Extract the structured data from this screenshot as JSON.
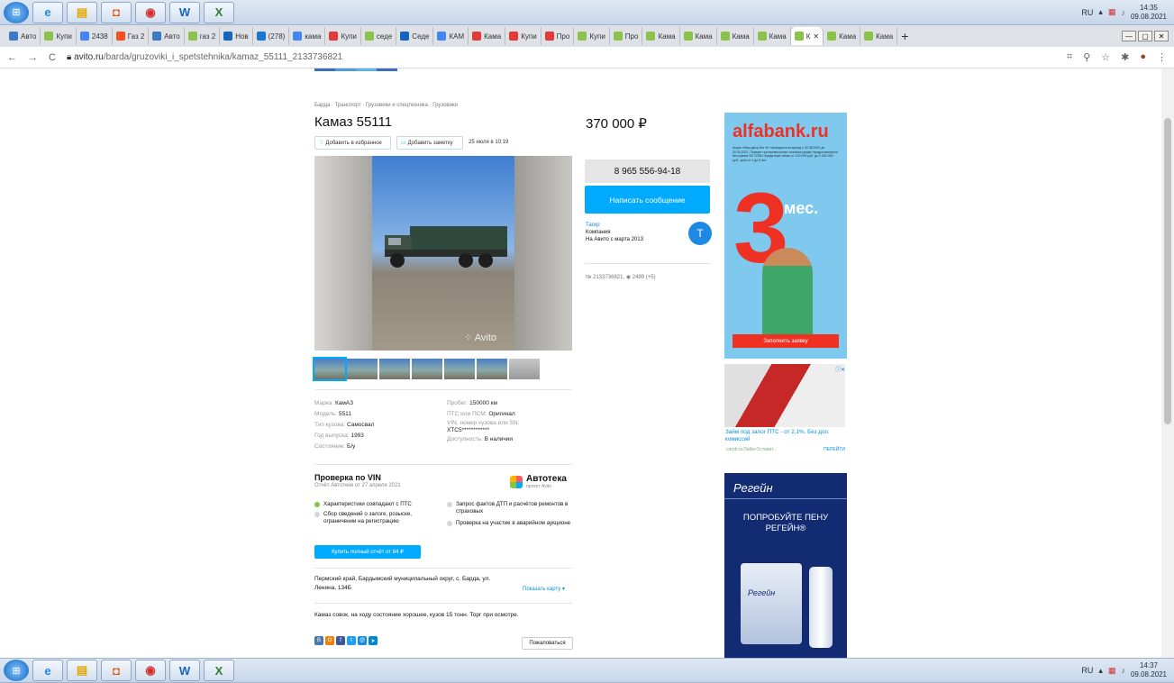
{
  "taskbar": {
    "lang": "RU",
    "time_top": "14:35",
    "date_top": "09.08.2021",
    "time_bottom": "14:37",
    "date_bottom": "09.08.2021"
  },
  "tabs": [
    {
      "label": "Авто",
      "color": "#3c7ac6"
    },
    {
      "label": "Купи",
      "color": "#8bc34a"
    },
    {
      "label": "2438",
      "color": "#4285f4"
    },
    {
      "label": "Газ 2",
      "color": "#f4511e"
    },
    {
      "label": "Авто",
      "color": "#3c7ac6"
    },
    {
      "label": "газ 2",
      "color": "#8bc34a"
    },
    {
      "label": "Нов",
      "color": "#1565c0"
    },
    {
      "label": "(278)",
      "color": "#1976d2"
    },
    {
      "label": "кама",
      "color": "#4285f4"
    },
    {
      "label": "Купи",
      "color": "#e53935"
    },
    {
      "label": "седе",
      "color": "#8bc34a"
    },
    {
      "label": "Седе",
      "color": "#1565c0"
    },
    {
      "label": "КАМ",
      "color": "#4285f4"
    },
    {
      "label": "Кама",
      "color": "#e53935"
    },
    {
      "label": "Купи",
      "color": "#e53935"
    },
    {
      "label": "Про",
      "color": "#e53935"
    },
    {
      "label": "Купи",
      "color": "#8bc34a"
    },
    {
      "label": "Про",
      "color": "#8bc34a"
    },
    {
      "label": "Кама",
      "color": "#8bc34a"
    },
    {
      "label": "Кама",
      "color": "#8bc34a"
    },
    {
      "label": "Кама",
      "color": "#8bc34a"
    },
    {
      "label": "Кама",
      "color": "#8bc34a"
    },
    {
      "label": "К",
      "color": "#8bc34a",
      "active": true
    },
    {
      "label": "Кама",
      "color": "#8bc34a"
    },
    {
      "label": "Кама",
      "color": "#8bc34a"
    }
  ],
  "address": {
    "host": "avito.ru",
    "path": "/barda/gruzoviki_i_spetstehnika/kamaz_55111_2133736821"
  },
  "listing": {
    "breadcrumb": "Барда · Транспорт · Грузовики и спецтехника · Грузовики",
    "title": "Камаз 55111",
    "price": "370 000 ₽",
    "fav_label": "Добавить в избранное",
    "note_label": "Добавить заметку",
    "date": "25 июля в 10:19",
    "watermark": "Avito",
    "props_left": [
      {
        "k": "Марка: ",
        "v": "КамАЗ"
      },
      {
        "k": "Модель: ",
        "v": "5511"
      },
      {
        "k": "Тип кузова: ",
        "v": "Самосвал"
      },
      {
        "k": "Год выпуска: ",
        "v": "1993"
      },
      {
        "k": "Состояние: ",
        "v": "Б/у"
      }
    ],
    "props_right": [
      {
        "k": "Пробег: ",
        "v": "150000 км"
      },
      {
        "k": "ПТС или ПСМ: ",
        "v": "Оригинал"
      },
      {
        "k": "VIN, номер кузова или SN:",
        "v": "XTC5************"
      },
      {
        "k": "Доступность: ",
        "v": "В наличии"
      }
    ],
    "vin": {
      "title": "Проверка по VIN",
      "subtitle": "Отчёт Автотеки от 27 апреля 2021",
      "brand": "Автотека",
      "brand_sub": "проект Avito",
      "checks_left": [
        "Характеристики совпадают с ПТС",
        "Сбор сведений о залоге, розыске, ограничении на регистрацию"
      ],
      "checks_right": [
        "Запрос фактов ДТП и расчётов ремонтов в страховых",
        "Проверка на участие в аварийном аукционе"
      ],
      "buy_label": "Купить полный отчёт от 84 ₽"
    },
    "address": "Пермский край, Бардымский муниципальный округ, с. Барда, ул. Ленина, 134Б",
    "show_map": "Показать карту",
    "description": "Камаз совок, на ходу состояние хорошее, кузов 15 тонн. Торг при осмотре.",
    "complain": "Пожаловаться",
    "phone": "8 965 556-94-18",
    "message_label": "Написать сообщение",
    "seller_name": "Тагир",
    "seller_type": "Компания",
    "seller_since": "На Авито с марта 2013",
    "avatar_letter": "Т",
    "ad_id": "№ 2133736821,",
    "views": "2499 (+5)"
  },
  "ads": {
    "alfa_brand": "alfabank.ru",
    "alfa_fine": "Акция «Наш двор без %» проводится в период с 02.08.2021 до 30.09.2021. Первые три ежемесячных платежа кредит предоставляется без суммы ФЛ СПКИ. Кредитный лимит от 100 000 руб. до 3 000 000 руб., срок от 1 до 5 лет.",
    "alfa_big": "3",
    "alfa_mes": "мес.",
    "alfa_cta": "Заполнить заявку",
    "loan_text": "Займ под залог ПТС - от 2,1%. Без доп. комиссий",
    "loan_src": "carpb.ru/Займ-Оставит...",
    "loan_go": "ПЕРЕЙТИ",
    "regein_brand": "Регейн",
    "regein_text": "ПОПРОБУЙТЕ ПЕНУ РЕГЕЙН®",
    "regein_pack": "Регейн"
  }
}
